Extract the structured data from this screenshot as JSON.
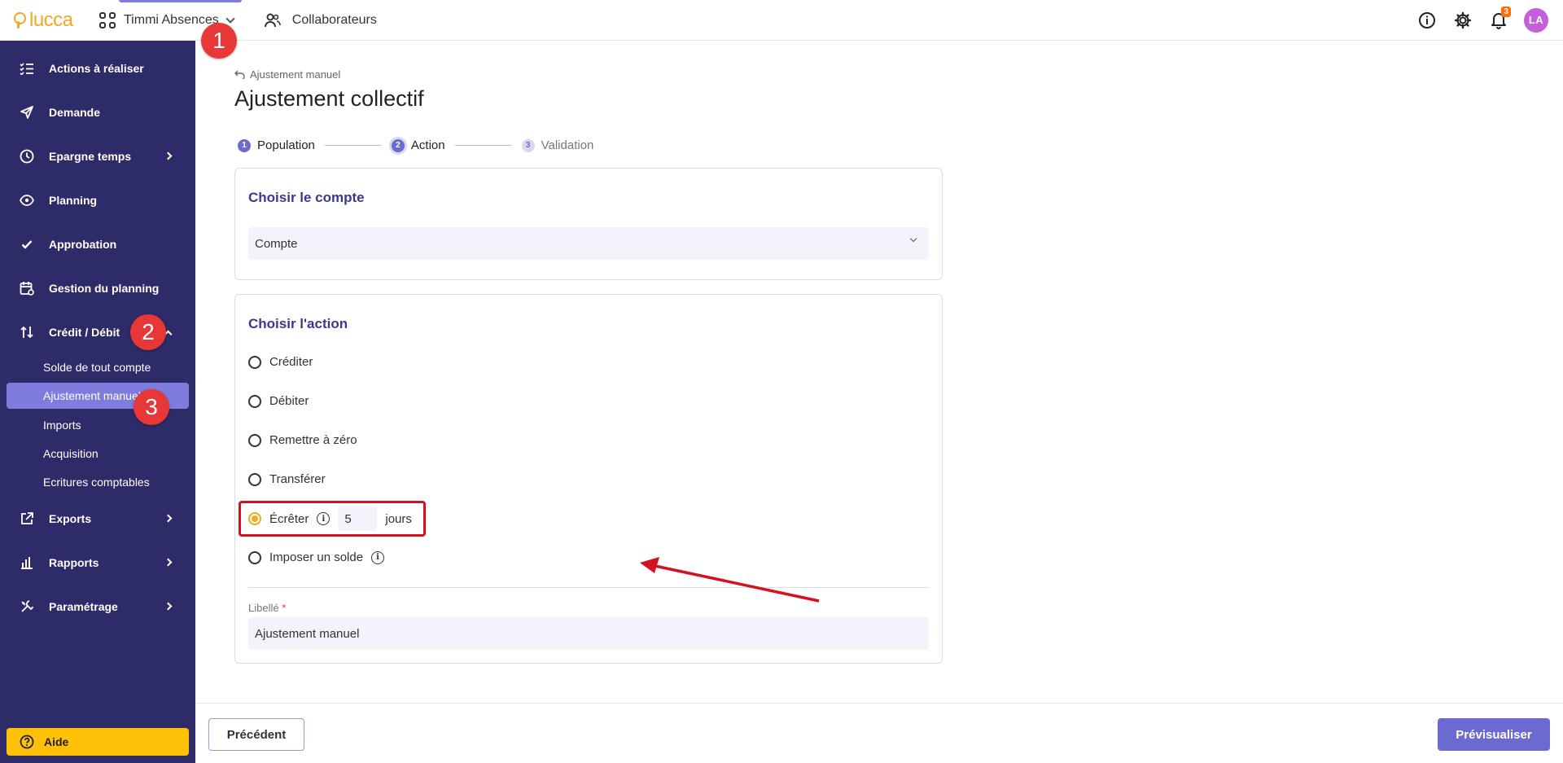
{
  "brand": {
    "logo_text": "lucca",
    "logo_color": "#f5a623"
  },
  "header": {
    "app_name": "Timmi Absences",
    "collaborators_label": "Collaborateurs",
    "notifications_count": "3",
    "avatar_initials": "LA"
  },
  "sidebar": {
    "items": [
      {
        "label": "Actions à réaliser",
        "icon": "checklist-icon"
      },
      {
        "label": "Demande",
        "icon": "send-icon"
      },
      {
        "label": "Epargne temps",
        "icon": "clock-icon"
      },
      {
        "label": "Planning",
        "icon": "eye-icon"
      },
      {
        "label": "Approbation",
        "icon": "check-icon"
      },
      {
        "label": "Gestion du planning",
        "icon": "calendar-gear-icon"
      },
      {
        "label": "Crédit / Débit",
        "icon": "up-down-arrows-icon"
      },
      {
        "label": "Exports",
        "icon": "external-link-icon"
      },
      {
        "label": "Rapports",
        "icon": "bar-chart-icon"
      },
      {
        "label": "Paramétrage",
        "icon": "tools-icon"
      }
    ],
    "sub_items": [
      {
        "label": "Solde de tout compte"
      },
      {
        "label": "Ajustement manuel"
      },
      {
        "label": "Imports"
      },
      {
        "label": "Acquisition"
      },
      {
        "label": "Ecritures comptables"
      }
    ],
    "help_label": "Aide"
  },
  "markers": {
    "one": "1",
    "two": "2",
    "three": "3"
  },
  "main": {
    "breadcrumb": "Ajustement manuel",
    "title": "Ajustement collectif",
    "steps": [
      {
        "num": "1",
        "label": "Population"
      },
      {
        "num": "2",
        "label": "Action"
      },
      {
        "num": "3",
        "label": "Validation"
      }
    ],
    "account_card": {
      "title": "Choisir le compte",
      "select_value": "Compte"
    },
    "action_card": {
      "title": "Choisir l'action",
      "options": [
        {
          "label": "Créditer"
        },
        {
          "label": "Débiter"
        },
        {
          "label": "Remettre à zéro"
        },
        {
          "label": "Transférer"
        },
        {
          "label": "Écrêter",
          "value": "5",
          "unit": "jours",
          "selected": true
        },
        {
          "label": "Imposer un solde"
        }
      ],
      "libelle_label": "Libellé",
      "libelle_value": "Ajustement manuel"
    }
  },
  "footer": {
    "prev_label": "Précédent",
    "next_label": "Prévisualiser"
  },
  "colors": {
    "sidebar_bg": "#2d2b68",
    "accent": "#6c6ad0",
    "active_sub": "#7e7cdd",
    "help_bg": "#ffc107",
    "annotation_red": "#d4111e"
  }
}
